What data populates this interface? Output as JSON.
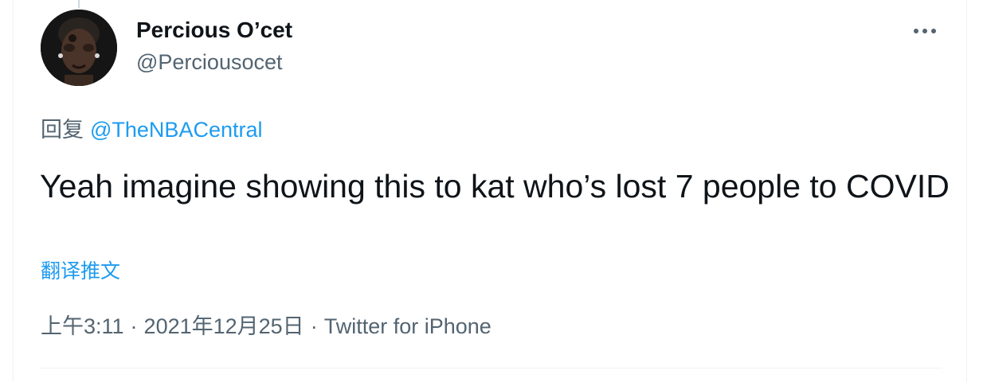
{
  "tweet": {
    "author": {
      "display_name": "Percious O’cet",
      "handle": "@Perciousocet"
    },
    "reply": {
      "prefix": "回复",
      "mention": "@TheNBACentral"
    },
    "text": "Yeah imagine showing this to kat who’s lost 7 people to COVID",
    "translate_label": "翻译推文",
    "meta": {
      "time": "上午3:11",
      "separator": "·",
      "date": "2021年12月25日",
      "source": "Twitter for iPhone"
    },
    "more_icon": "ellipsis-icon"
  },
  "colors": {
    "text": "#0f1419",
    "secondary": "#536471",
    "link": "#1d9bf0",
    "border": "#eff3f4"
  }
}
